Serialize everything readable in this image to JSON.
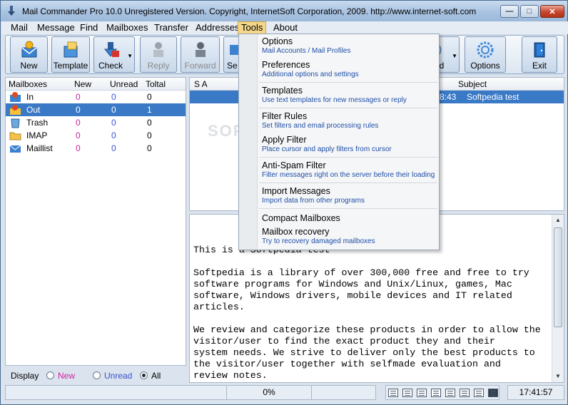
{
  "window": {
    "title": "Mail Commander Pro 10.0 Unregistered Version. Copyright, InternetSoft Corporation, 2009. http://www.internet-soft.com"
  },
  "menubar": {
    "items": [
      "Mail",
      "Message",
      "Find",
      "Mailboxes",
      "Transfer",
      "Addresses",
      "Tools",
      "About"
    ],
    "active": "Tools"
  },
  "toolbar": {
    "buttons": [
      {
        "label": "New",
        "icon": "new-mail-icon"
      },
      {
        "label": "Template",
        "icon": "template-icon"
      },
      {
        "label": "Check",
        "icon": "check-mail-icon"
      },
      {
        "label": "Reply",
        "icon": "reply-icon"
      },
      {
        "label": "Forward",
        "icon": "forward-icon"
      },
      {
        "label": "Se",
        "icon": "send-icon"
      },
      {
        "label": "nd",
        "icon": "send-receive-icon"
      },
      {
        "label": "Options",
        "icon": "gear-icon"
      },
      {
        "label": "Exit",
        "icon": "exit-door-icon"
      }
    ]
  },
  "mailboxes": {
    "headers": [
      "Mailboxes",
      "New",
      "Unread",
      "Toltal"
    ],
    "rows": [
      {
        "name": "In",
        "new": "0",
        "unread": "0",
        "total": "0",
        "icon": "inbox-icon"
      },
      {
        "name": "Out",
        "new": "0",
        "unread": "0",
        "total": "1",
        "icon": "outbox-icon"
      },
      {
        "name": "Trash",
        "new": "0",
        "unread": "0",
        "total": "0",
        "icon": "trash-icon"
      },
      {
        "name": "IMAP",
        "new": "0",
        "unread": "0",
        "total": "0",
        "icon": "folder-icon"
      },
      {
        "name": "Maillist",
        "new": "0",
        "unread": "0",
        "total": "0",
        "icon": "maillist-icon"
      }
    ],
    "selected_index": 1
  },
  "display": {
    "label": "Display",
    "options": [
      "New",
      "Unread",
      "All"
    ],
    "selected": "All"
  },
  "message_list": {
    "headers": [
      "S A",
      "Subject"
    ],
    "rows": [
      {
        "time_fragment": "8:43",
        "subject": "Softpedia test"
      }
    ],
    "watermark": "SOFTP"
  },
  "preview": {
    "body": "This is a Softpedia test\n\nSoftpedia is a library of over 300,000 free and free to try\nsoftware programs for Windows and Unix/Linux, games, Mac\nsoftware, Windows drivers, mobile devices and IT related\narticles.\n\nWe review and categorize these products in order to allow the\nvisitor/user to find the exact product they and their\nsystem needs. We strive to deliver only the best products to\nthe visitor/user together with selfmade evaluation and\nreview notes."
  },
  "statusbar": {
    "progress": "0%",
    "time": "17:41:57"
  },
  "tools_menu": {
    "items": [
      {
        "title": "Options",
        "desc": "Mail Accounts / Mail Profiles"
      },
      {
        "title": "Preferences",
        "desc": "Additional options and settings"
      },
      {
        "title": "Templates",
        "desc": "Use text templates for new messages or reply"
      },
      {
        "title": "Filter Rules",
        "desc": "Set filters and email processing rules"
      },
      {
        "title": "Apply Filter",
        "desc": "Place cursor and apply filters from cursor"
      },
      {
        "title": "Anti-Spam Filter",
        "desc": "Filter messages right on the server before their loading"
      },
      {
        "title": "Import Messages",
        "desc": "Import data from other programs"
      },
      {
        "title": "Compact Mailboxes",
        "desc": ""
      },
      {
        "title": "Mailbox recovery",
        "desc": "Try to recovery damaged mailboxes"
      }
    ]
  }
}
